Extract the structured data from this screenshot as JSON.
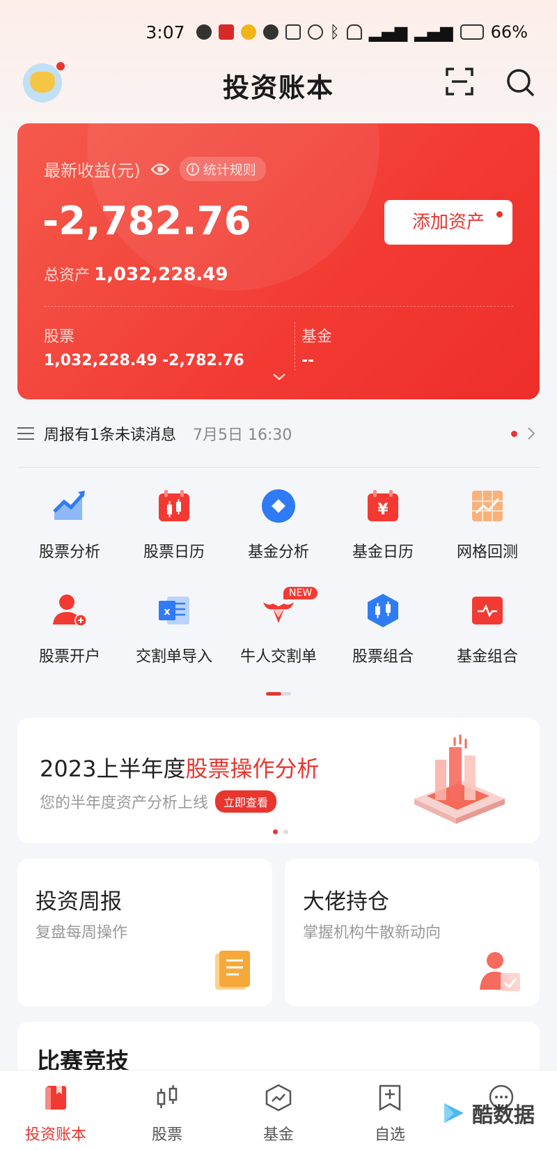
{
  "status_bar": {
    "time": "3:07",
    "battery": "66%"
  },
  "header": {
    "title": "投资账本"
  },
  "profit_card": {
    "label": "最新收益(元)",
    "rules": "统计规则",
    "profit": "-2,782.76",
    "add_asset": "添加资产",
    "total_label": "总资产",
    "total_value": "1,032,228.49",
    "stock_label": "股票",
    "stock_total": "1,032,228.49",
    "stock_profit": "-2,782.76",
    "fund_label": "基金",
    "fund_value": "--"
  },
  "notice": {
    "text": "周报有1条未读消息",
    "time": "7月5日 16:30"
  },
  "grid": {
    "row1": [
      "股票分析",
      "股票日历",
      "基金分析",
      "基金日历",
      "网格回测"
    ],
    "row2": [
      "股票开户",
      "交割单导入",
      "牛人交割单",
      "股票组合",
      "基金组合"
    ],
    "new_badge": "NEW"
  },
  "banner": {
    "title_prefix": "2023上半年度",
    "title_highlight": "股票操作分析",
    "subtitle": "您的半年度资产分析上线",
    "button": "立即查看"
  },
  "cards": {
    "weekly_title": "投资周报",
    "weekly_sub": "复盘每周操作",
    "holdings_title": "大佬持仓",
    "holdings_sub": "掌握机构牛散新动向"
  },
  "compete": {
    "title": "比赛竞技"
  },
  "bottom_nav": [
    "投资账本",
    "股票",
    "基金",
    "自选"
  ],
  "watermark": "酷数据",
  "colors": {
    "accent": "#e8362f",
    "card_red": "#f23a33",
    "blue_icon": "#2f7bf5"
  }
}
